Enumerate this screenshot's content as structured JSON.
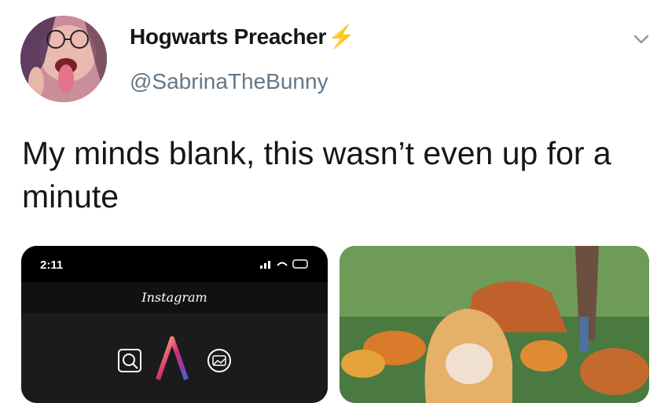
{
  "tweet": {
    "display_name": "Hogwarts Preacher",
    "badge_emoji": "⚡",
    "handle": "@SabrinaTheBunny",
    "text": "My minds blank, this wasn’t even up for a minute"
  },
  "media": {
    "left": {
      "status_time": "2:11",
      "app_title": "Instagram"
    }
  },
  "colors": {
    "name": "#14171a",
    "handle": "#657786",
    "bolt": "#f5a623"
  }
}
